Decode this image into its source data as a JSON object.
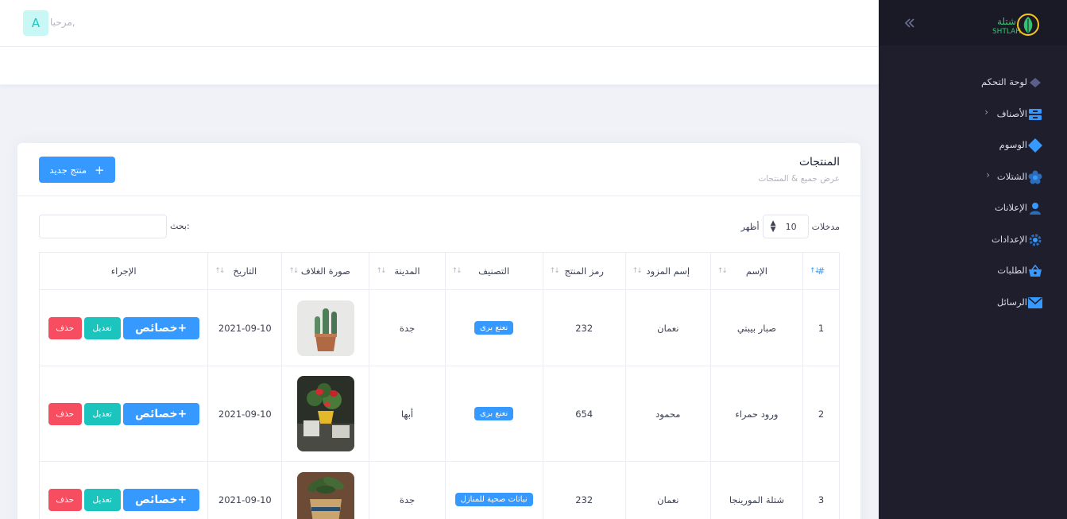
{
  "header": {
    "greeting": "مرحبا,",
    "avatar_letter": "A"
  },
  "sidebar": {
    "brand": {
      "arabic": "شتلة",
      "latin": "SHTLAH"
    },
    "items": [
      {
        "label": "لوحة التحكم",
        "icon": "diamond-layers-icon",
        "has_arrow": false
      },
      {
        "label": "الأصناف",
        "icon": "server-icon",
        "has_arrow": true
      },
      {
        "label": "الوسوم",
        "icon": "diamond-icon",
        "has_arrow": false
      },
      {
        "label": "الشتلات",
        "icon": "flower-icon",
        "has_arrow": true
      },
      {
        "label": "الإعلانات",
        "icon": "users-icon",
        "has_arrow": false
      },
      {
        "label": "الإعدادات",
        "icon": "gear-icon",
        "has_arrow": false
      },
      {
        "label": "الطلبات",
        "icon": "basket-icon",
        "has_arrow": false
      },
      {
        "label": "الرسائل",
        "icon": "mail-icon",
        "has_arrow": false
      }
    ]
  },
  "card": {
    "title": "المنتجات",
    "subtitle": "عرض جميع & المنتجات",
    "new_button": "منتج جديد",
    "show_label": "أظهر",
    "entries_value": "10",
    "entries_label": "مدخلات",
    "search_label": "بحث:",
    "search_value": ""
  },
  "table": {
    "headers": [
      "#",
      "الإسم",
      "إسم المزود",
      "رمز المنتج",
      "التصنيف",
      "المدينة",
      "صورة الغلاف",
      "التاريخ",
      "الإجراء"
    ],
    "rows": [
      {
        "num": "1",
        "name": "صبار بيبتي",
        "supplier": "نعمان",
        "code": "232",
        "category": "نعنع برى",
        "city": "جدة",
        "date": "2021-09-10"
      },
      {
        "num": "2",
        "name": "ورود حمراء",
        "supplier": "محمود",
        "code": "654",
        "category": "نعنع برى",
        "city": "أبها",
        "date": "2021-09-10"
      },
      {
        "num": "3",
        "name": "شتلة المورينجا",
        "supplier": "نعمان",
        "code": "232",
        "category": "نباتات صحية للمنازل",
        "city": "جدة",
        "date": "2021-09-10"
      }
    ],
    "actions": {
      "props": "خصائص",
      "edit": "تعديل",
      "delete": "حذف"
    }
  },
  "colors": {
    "primary": "#3699ff",
    "success": "#1bc5bd",
    "danger": "#f64e60",
    "sidebar": "#1e1e2d"
  }
}
